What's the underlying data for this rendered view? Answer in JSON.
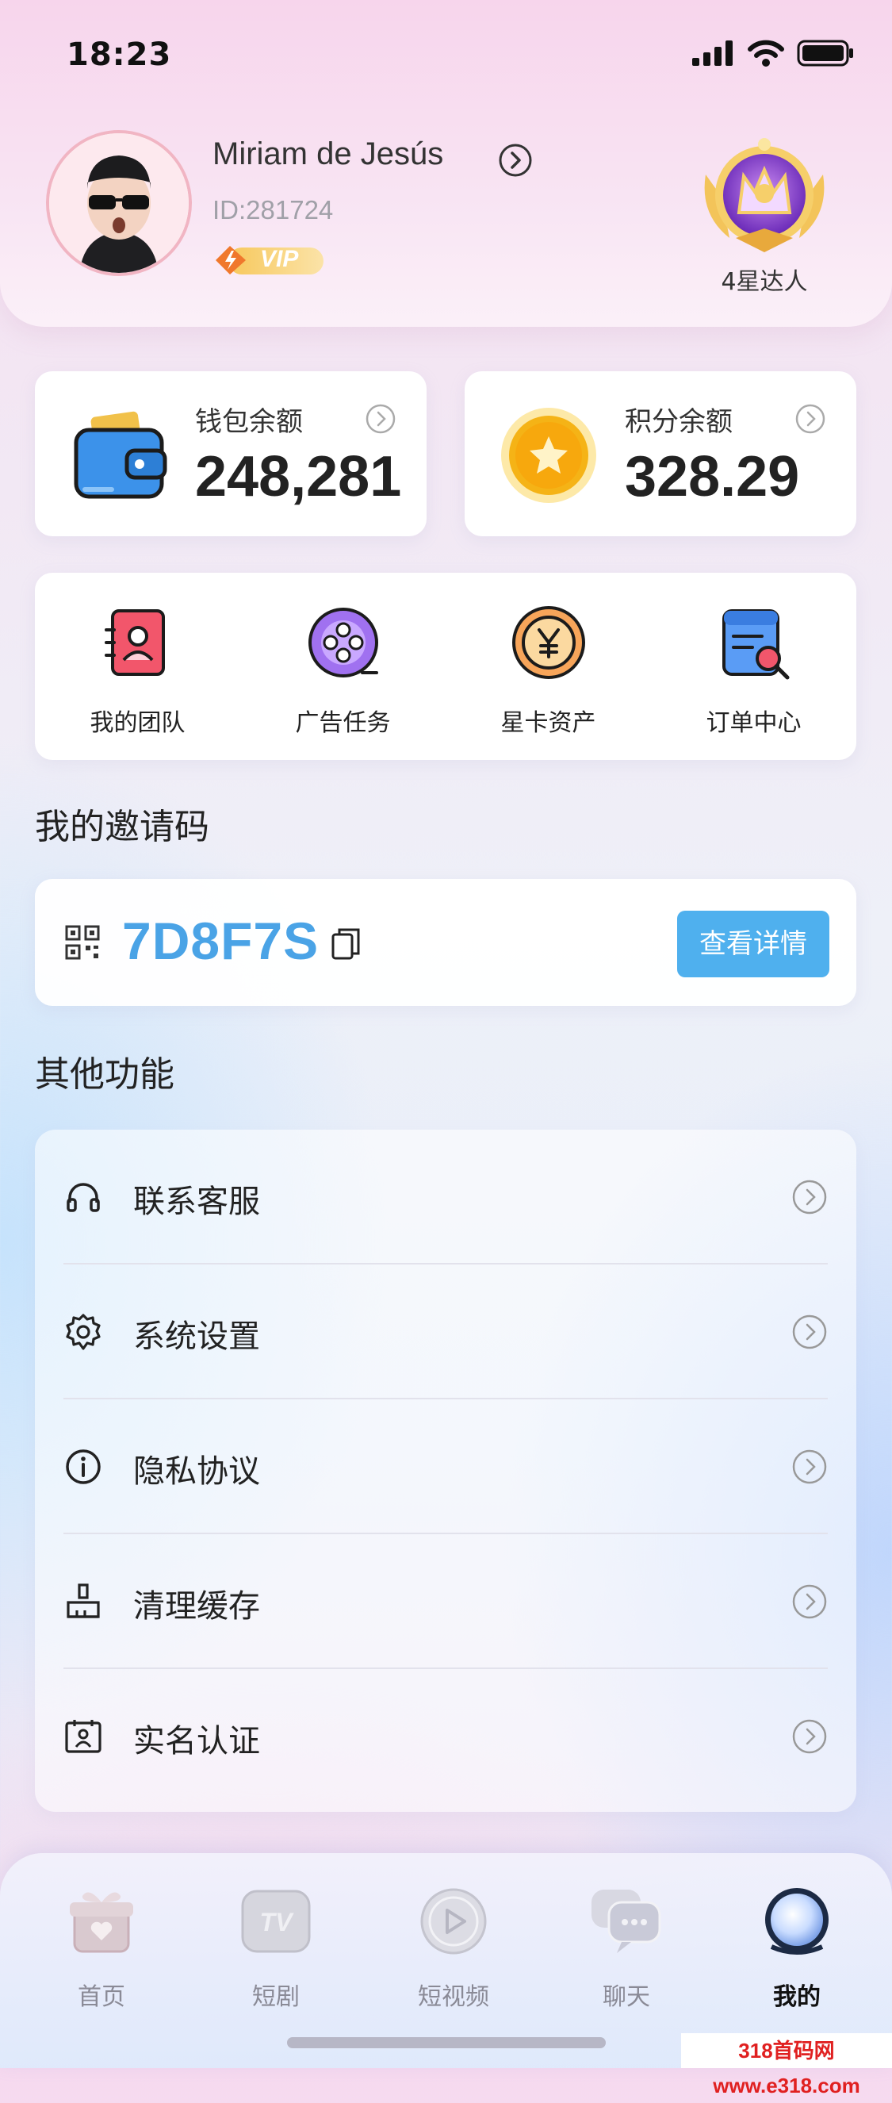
{
  "status_bar": {
    "time": "18:23"
  },
  "profile": {
    "name": "Miriam de Jesús",
    "id": "ID:281724",
    "vip": "VIP",
    "badge_label": "4星达人"
  },
  "balances": {
    "wallet": {
      "title": "钱包余额",
      "value": "248,281"
    },
    "points": {
      "title": "积分余额",
      "value": "328.29"
    }
  },
  "quick_actions": [
    {
      "label": "我的团队",
      "icon": "team-icon"
    },
    {
      "label": "广告任务",
      "icon": "ad-task-icon"
    },
    {
      "label": "星卡资产",
      "icon": "yen-coin-icon"
    },
    {
      "label": "订单中心",
      "icon": "order-search-icon"
    }
  ],
  "invite": {
    "section_title": "我的邀请码",
    "code": "7D8F7S",
    "details_button": "查看详情"
  },
  "other": {
    "section_title": "其他功能",
    "items": [
      {
        "label": "联系客服",
        "icon": "headset-icon"
      },
      {
        "label": "系统设置",
        "icon": "gear-icon"
      },
      {
        "label": "隐私协议",
        "icon": "info-icon"
      },
      {
        "label": "清理缓存",
        "icon": "broom-icon"
      },
      {
        "label": "实名认证",
        "icon": "id-card-icon"
      }
    ]
  },
  "tabbar": {
    "tabs": [
      {
        "label": "首页",
        "icon": "gift-icon"
      },
      {
        "label": "短剧",
        "icon": "tv-icon"
      },
      {
        "label": "短视频",
        "icon": "play-icon"
      },
      {
        "label": "聊天",
        "icon": "chat-icon"
      },
      {
        "label": "我的",
        "icon": "profile-orb-icon",
        "active": true
      }
    ]
  },
  "watermark": "318首码网 www.e318.com",
  "colors": {
    "accent": "#4fb0ee",
    "invite_code": "#4aa3e6",
    "header_pink": "#f7d5ec"
  }
}
